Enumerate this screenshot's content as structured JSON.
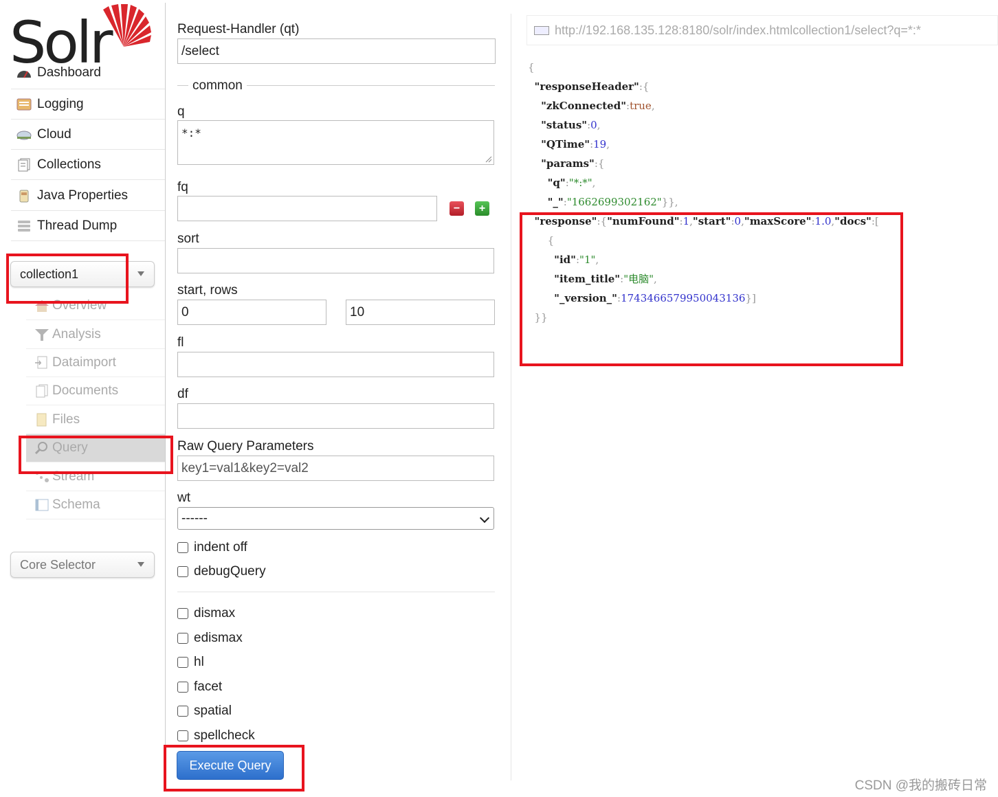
{
  "sidebar": {
    "logo_text": "Solr",
    "main_nav": [
      {
        "label": "Dashboard",
        "icon": "dashboard-icon"
      },
      {
        "label": "Logging",
        "icon": "logging-icon"
      },
      {
        "label": "Cloud",
        "icon": "cloud-icon"
      },
      {
        "label": "Collections",
        "icon": "collections-icon"
      },
      {
        "label": "Java Properties",
        "icon": "java-icon"
      },
      {
        "label": "Thread Dump",
        "icon": "thread-dump-icon"
      }
    ],
    "collection_selector": "collection1",
    "collection_nav": [
      {
        "label": "Overview",
        "icon": "home-icon"
      },
      {
        "label": "Analysis",
        "icon": "funnel-icon"
      },
      {
        "label": "Dataimport",
        "icon": "dataimport-icon"
      },
      {
        "label": "Documents",
        "icon": "documents-icon"
      },
      {
        "label": "Files",
        "icon": "files-icon"
      },
      {
        "label": "Query",
        "icon": "search-icon"
      },
      {
        "label": "Stream",
        "icon": "stream-icon"
      },
      {
        "label": "Schema",
        "icon": "schema-icon"
      }
    ],
    "core_selector": "Core Selector"
  },
  "form": {
    "request_handler_label": "Request-Handler (qt)",
    "request_handler_value": "/select",
    "common_legend": "common",
    "q_label": "q",
    "q_value": "*:*",
    "fq_label": "fq",
    "fq_value": "",
    "sort_label": "sort",
    "start_rows_label": "start, rows",
    "start_value": "0",
    "rows_value": "10",
    "fl_label": "fl",
    "df_label": "df",
    "raw_label": "Raw Query Parameters",
    "raw_placeholder": "key1=val1&key2=val2",
    "wt_label": "wt",
    "wt_value": "------",
    "checkboxes_top": [
      "indent off",
      "debugQuery"
    ],
    "checkboxes_bottom": [
      "dismax",
      "edismax",
      "hl",
      "facet",
      "spatial",
      "spellcheck"
    ],
    "execute_label": "Execute Query"
  },
  "result": {
    "url": "http://192.168.135.128:8180/solr/index.htmlcollection1/select?q=*:*",
    "responseHeader": {
      "zkConnected": "true",
      "status": "0",
      "QTime": "19",
      "q": "\"*:*\"",
      "underscore": "\"1662699302162\""
    },
    "response": {
      "numFound": "1",
      "start": "0",
      "maxScore": "1.0"
    },
    "doc": {
      "id": "\"1\"",
      "item_title": "\"电脑\"",
      "version": "1743466579950043136"
    }
  },
  "watermark": "CSDN @我的搬砖日常",
  "colors": {
    "highlight": "#e8141e",
    "execute_button": "#2d6fcc",
    "active_item": "#d9d9d9"
  }
}
